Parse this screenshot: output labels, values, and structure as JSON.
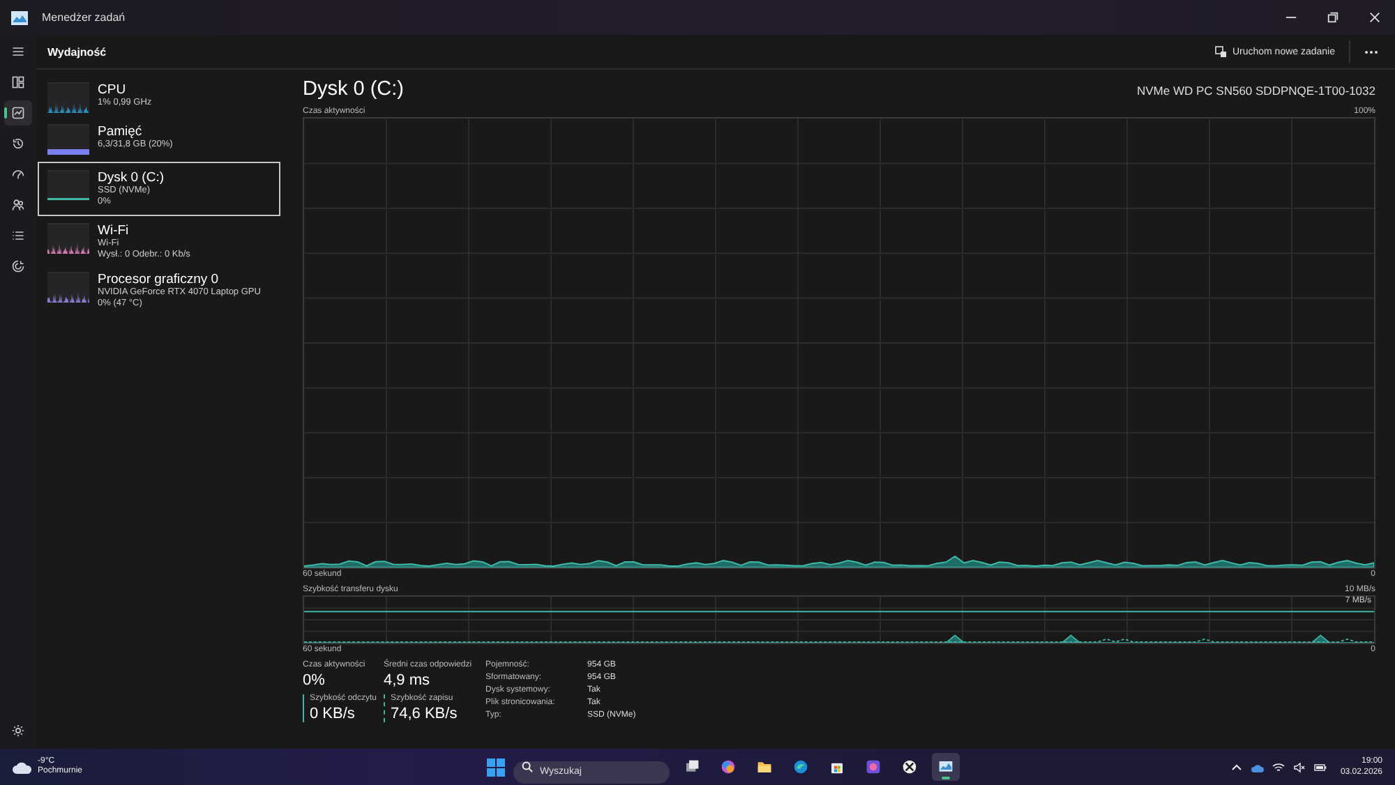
{
  "window": {
    "title": "Menedżer zadań"
  },
  "nav": [
    {
      "kind": "menu",
      "selected": false
    },
    {
      "kind": "processes",
      "selected": false
    },
    {
      "kind": "performance",
      "selected": true
    },
    {
      "kind": "history",
      "selected": false
    },
    {
      "kind": "startup",
      "selected": false
    },
    {
      "kind": "users",
      "selected": false
    },
    {
      "kind": "details",
      "selected": false
    },
    {
      "kind": "services",
      "selected": false
    }
  ],
  "header": {
    "title": "Wydajność",
    "run_task": "Uruchom nowe zadanie"
  },
  "devices": [
    {
      "name": "CPU",
      "lines": [
        "1% 0,99 GHz"
      ],
      "kind": "spikes",
      "color": "#2a8fbf",
      "selected": false
    },
    {
      "name": "Pamięć",
      "lines": [
        "6,3/31,8 GB (20%)"
      ],
      "kind": "fill",
      "color": "#7a7ff0",
      "selected": false
    },
    {
      "name": "Dysk 0 (C:)",
      "lines": [
        "SSD (NVMe)",
        "0%"
      ],
      "kind": "line",
      "color": "#3fb8a8",
      "selected": true
    },
    {
      "name": "Wi-Fi",
      "lines": [
        "Wi-Fi",
        "Wysł.: 0 Odebr.: 0 Kb/s"
      ],
      "kind": "spikes",
      "color": "#d17bb0",
      "selected": false
    },
    {
      "name": "Procesor graficzny 0",
      "lines": [
        "NVIDIA GeForce RTX 4070 Laptop GPU",
        "0% (47 °C)"
      ],
      "kind": "spikes",
      "color": "#8a7fd8",
      "selected": false
    }
  ],
  "main": {
    "title": "Dysk 0 (C:)",
    "model": "NVMe WD PC SN560 SDDPNQE-1T00-1032",
    "activity": {
      "label": "Czas aktywności",
      "max": "100%",
      "time": "60 sekund",
      "min": "0"
    },
    "transfer": {
      "label": "Szybkość transferu dysku",
      "max": "10 MB/s",
      "mark": "7 MB/s",
      "time": "60 sekund",
      "min": "0"
    },
    "stats": [
      {
        "label": "Czas aktywności",
        "value": "0%"
      },
      {
        "label": "Średni czas odpowiedzi",
        "value": "4,9 ms"
      }
    ],
    "rates": [
      {
        "label": "Szybkość odczytu",
        "value": "0 KB/s",
        "kind": "solid"
      },
      {
        "label": "Szybkość zapisu",
        "value": "74,6 KB/s",
        "kind": "dashed"
      }
    ],
    "properties": [
      {
        "label": "Pojemność:",
        "value": "954 GB"
      },
      {
        "label": "Sformatowany:",
        "value": "954 GB"
      },
      {
        "label": "Dysk systemowy:",
        "value": "Tak"
      },
      {
        "label": "Plik stronicowania:",
        "value": "Tak"
      },
      {
        "label": "Typ:",
        "value": "SSD (NVMe)"
      }
    ]
  },
  "taskbar": {
    "temperature": "-9°C",
    "weather": "Pochmurnie",
    "search_placeholder": "Wyszukaj",
    "apps": [
      {
        "kind": "taskview",
        "selected": false
      },
      {
        "kind": "copilot",
        "selected": false
      },
      {
        "kind": "folder",
        "selected": false
      },
      {
        "kind": "edge",
        "selected": false
      },
      {
        "kind": "store",
        "selected": false
      },
      {
        "kind": "photo",
        "selected": false
      },
      {
        "kind": "xbox",
        "selected": false
      },
      {
        "kind": "monitor",
        "selected": true
      }
    ],
    "time": "19:00",
    "date": "03.02.2026"
  }
}
